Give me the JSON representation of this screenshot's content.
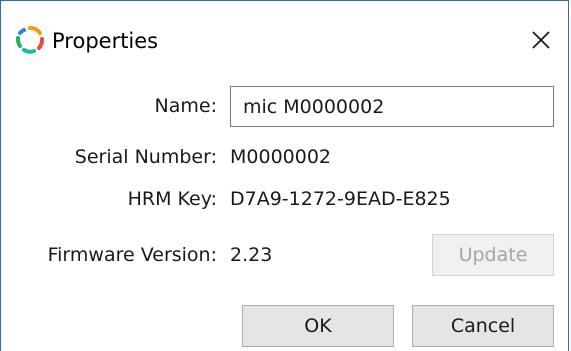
{
  "window": {
    "title": "Properties"
  },
  "fields": {
    "name_label": "Name:",
    "name_value": "mic M0000002",
    "serial_label": "Serial Number:",
    "serial_value": "M0000002",
    "hrm_label": "HRM Key:",
    "hrm_value": "D7A9-1272-9EAD-E825",
    "firmware_label": "Firmware Version:",
    "firmware_value": "2.23"
  },
  "buttons": {
    "update_label": "Update",
    "ok_label": "OK",
    "cancel_label": "Cancel"
  },
  "icons": {
    "app": "app-logo-icon",
    "close": "close-icon"
  },
  "colors": {
    "window_border": "#2b6cb3",
    "logo_orange": "#f39c12",
    "logo_red": "#e74c3c",
    "logo_blue": "#2e86de",
    "logo_green": "#27ae60",
    "logo_teal": "#1abc9c"
  }
}
